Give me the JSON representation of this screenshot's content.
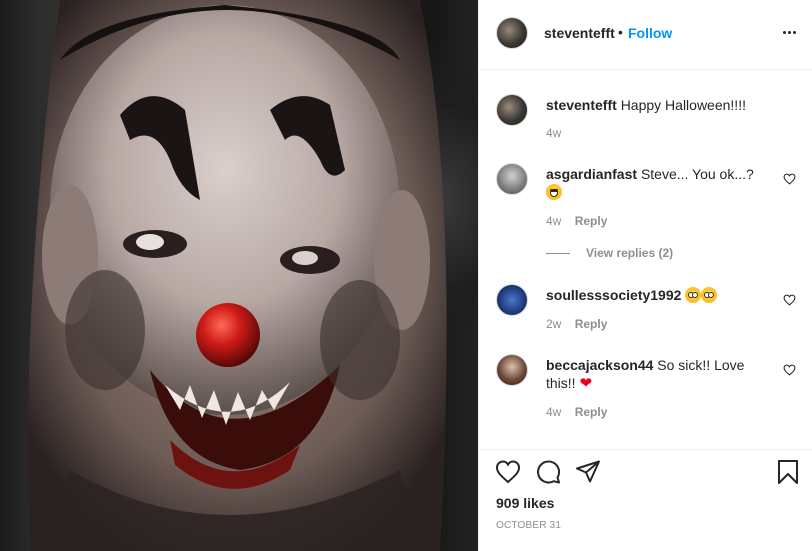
{
  "post": {
    "photo_icon": "clown-tattoo-photo",
    "author": "steventefft",
    "follow_label": "Follow",
    "separator": "•",
    "caption": {
      "username": "steventefft",
      "text": "Happy Halloween!!!!",
      "age": "4w"
    },
    "comments": [
      {
        "username": "asgardianfast",
        "text": "Steve... You ok...?",
        "emoji": "grinning-sweat-emoji",
        "age": "4w",
        "reply_label": "Reply"
      },
      {
        "username": "soullesssociety1992",
        "text": "",
        "emoji": "flushed-emoji",
        "age": "2w",
        "reply_label": "Reply"
      },
      {
        "username": "beccajackson44",
        "text": "So sick!! Love this!!",
        "emoji": "red-heart-emoji",
        "age": "4w",
        "reply_label": "Reply"
      }
    ],
    "view_replies_label": "View replies (2)",
    "likes": "909 likes",
    "date": "OCTOBER 31",
    "colors": {
      "link": "#0095f6",
      "muted": "#8e8e8e",
      "text": "#262626",
      "divider": "#efefef",
      "heart": "#e8001f"
    }
  }
}
